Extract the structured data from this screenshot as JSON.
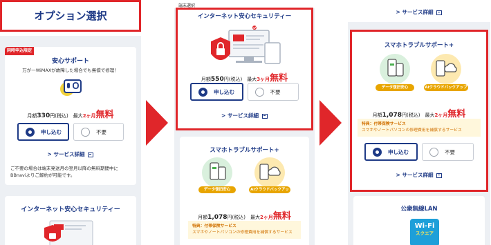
{
  "panel1": {
    "page_title": "オプション選択",
    "anshin": {
      "tag": "同時申込限定",
      "title": "安心サポート",
      "desc": "万が一WiMAXが故障した場合でも無償で修理！",
      "monthly": "月額",
      "price": "330",
      "unit": "円(税込)",
      "max": "最大",
      "months": "2ヶ月",
      "free": "無料",
      "apply": "申し込む",
      "decline": "不要",
      "detail": "サービス詳細",
      "note": "ご不要の場合は端末発送月の翌月以降の無料期間中に BBnaviよりご解約が可能です。"
    },
    "security_title": "インターネット安心セキュリティー"
  },
  "panel2": {
    "header": "端末選択",
    "security": {
      "title": "インターネット安心セキュリティー",
      "monthly": "月額",
      "price": "550",
      "unit": "円(税込)",
      "max": "最大",
      "months": "3ヶ月",
      "free": "無料",
      "apply": "申し込む",
      "decline": "不要",
      "detail": "サービス詳細"
    },
    "smartphone": {
      "title": "スマホトラブルサポート+",
      "chip_data": "データ復旧安心",
      "chip_cloud": "AIクラウドバックアップ",
      "monthly": "月額",
      "price": "1,078",
      "unit": "円(税込)",
      "max": "最大",
      "months": "2ヶ月",
      "free": "無料",
      "perk_label": "特典：付帯保険サービス",
      "perk_text": "スマホやノートパソコンの修理費用を補償するサービス"
    }
  },
  "panel3": {
    "top_detail": "サービス詳細",
    "smartphone": {
      "title": "スマホトラブルサポート+",
      "chip_data": "データ復旧安心",
      "chip_cloud": "AIクラウドバックアップ",
      "monthly": "月額",
      "price": "1,078",
      "unit": "円(税込)",
      "max": "最大",
      "months": "2ヶ月",
      "free": "無料",
      "perk_label": "特典：付帯保険サービス",
      "perk_text": "スマホやノートパソコンの修理費用を補償するサービス",
      "apply": "申し込む",
      "decline": "不要",
      "detail": "サービス詳細"
    },
    "wifi_title": "公衆無線LAN",
    "wifi_logo": "Wi-Fi",
    "wifi_logo_sub": "スクエア"
  },
  "colors": {
    "accent_red": "#e0262a",
    "navy": "#1e3a86",
    "panel_bg": "#edf0f4",
    "perk_bg": "#fff7dc",
    "perk_text": "#d07000"
  }
}
